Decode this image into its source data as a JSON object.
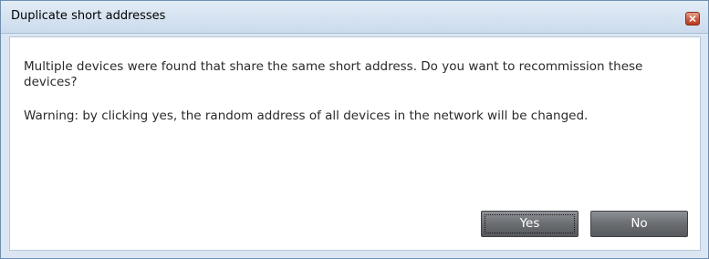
{
  "dialog": {
    "title": "Duplicate short addresses",
    "message": "Multiple devices were found that share the same short address. Do you want to recommission these devices?",
    "warning": "Warning: by clicking yes, the random address of all devices in the network will be changed.",
    "buttons": {
      "yes": "Yes",
      "no": "No"
    },
    "close_icon": "close-icon",
    "colors": {
      "titlebar": "#d6e3f1",
      "close_button": "#d2573a",
      "button": "#6a6d71",
      "text": "#2a2a2a"
    }
  }
}
